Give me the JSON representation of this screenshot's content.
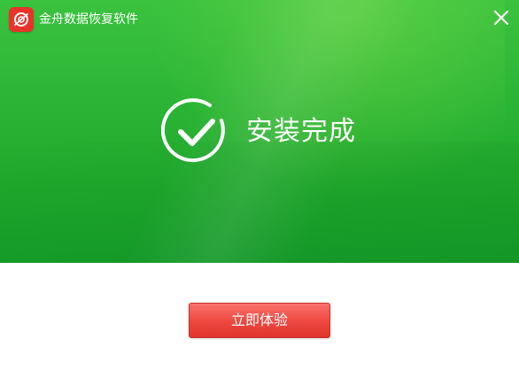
{
  "window": {
    "title": "金舟数据恢复软件",
    "close_icon": "close-icon",
    "logo_icon": "app-logo-icon"
  },
  "status": {
    "icon": "check-circle-icon",
    "text": "安装完成"
  },
  "actions": {
    "start_label": "立即体验"
  },
  "colors": {
    "banner_green": "#2fb837",
    "button_red": "#ef4a42",
    "logo_red": "#e8332a"
  }
}
